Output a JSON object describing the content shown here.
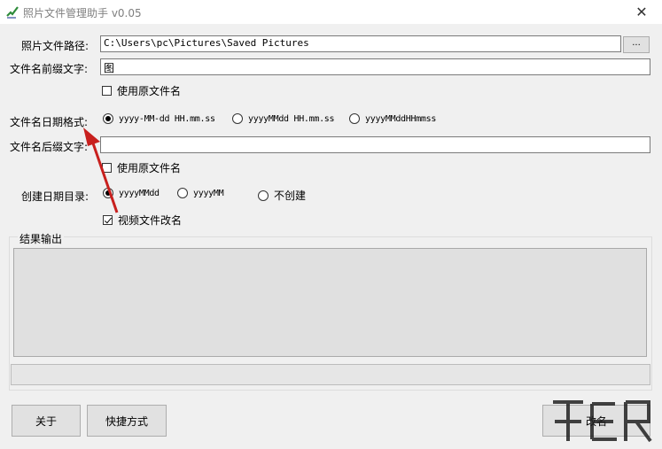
{
  "window": {
    "title": "照片文件管理助手 v0.05",
    "close_glyph": "✕"
  },
  "form": {
    "photo_path_label": "照片文件路径:",
    "photo_path_value": "C:\\Users\\pc\\Pictures\\Saved Pictures",
    "browse_label": "...",
    "prefix_label": "文件名前缀文字:",
    "prefix_value": "图",
    "prefix_use_original": "使用原文件名",
    "date_format_label": "文件名日期格式:",
    "date_formats": [
      "yyyy-MM-dd HH.mm.ss",
      "yyyyMMdd HH.mm.ss",
      "yyyyMMddHHmmss"
    ],
    "date_format_selected": 0,
    "suffix_label": "文件名后缀文字:",
    "suffix_value": "",
    "suffix_use_original": "使用原文件名",
    "date_dir_label": "创建日期目录:",
    "date_dir_options": [
      "yyyyMMdd",
      "yyyyMM",
      "不创建"
    ],
    "date_dir_selected": 0,
    "video_rename_label": "视频文件改名",
    "video_rename_checked": true
  },
  "output": {
    "group_label": "结果输出",
    "text": ""
  },
  "buttons": {
    "about": "关于",
    "shortcut": "快捷方式",
    "rename": "改名"
  },
  "colors": {
    "annotation_arrow": "#c8201e",
    "title_text": "#7f7f7f"
  }
}
